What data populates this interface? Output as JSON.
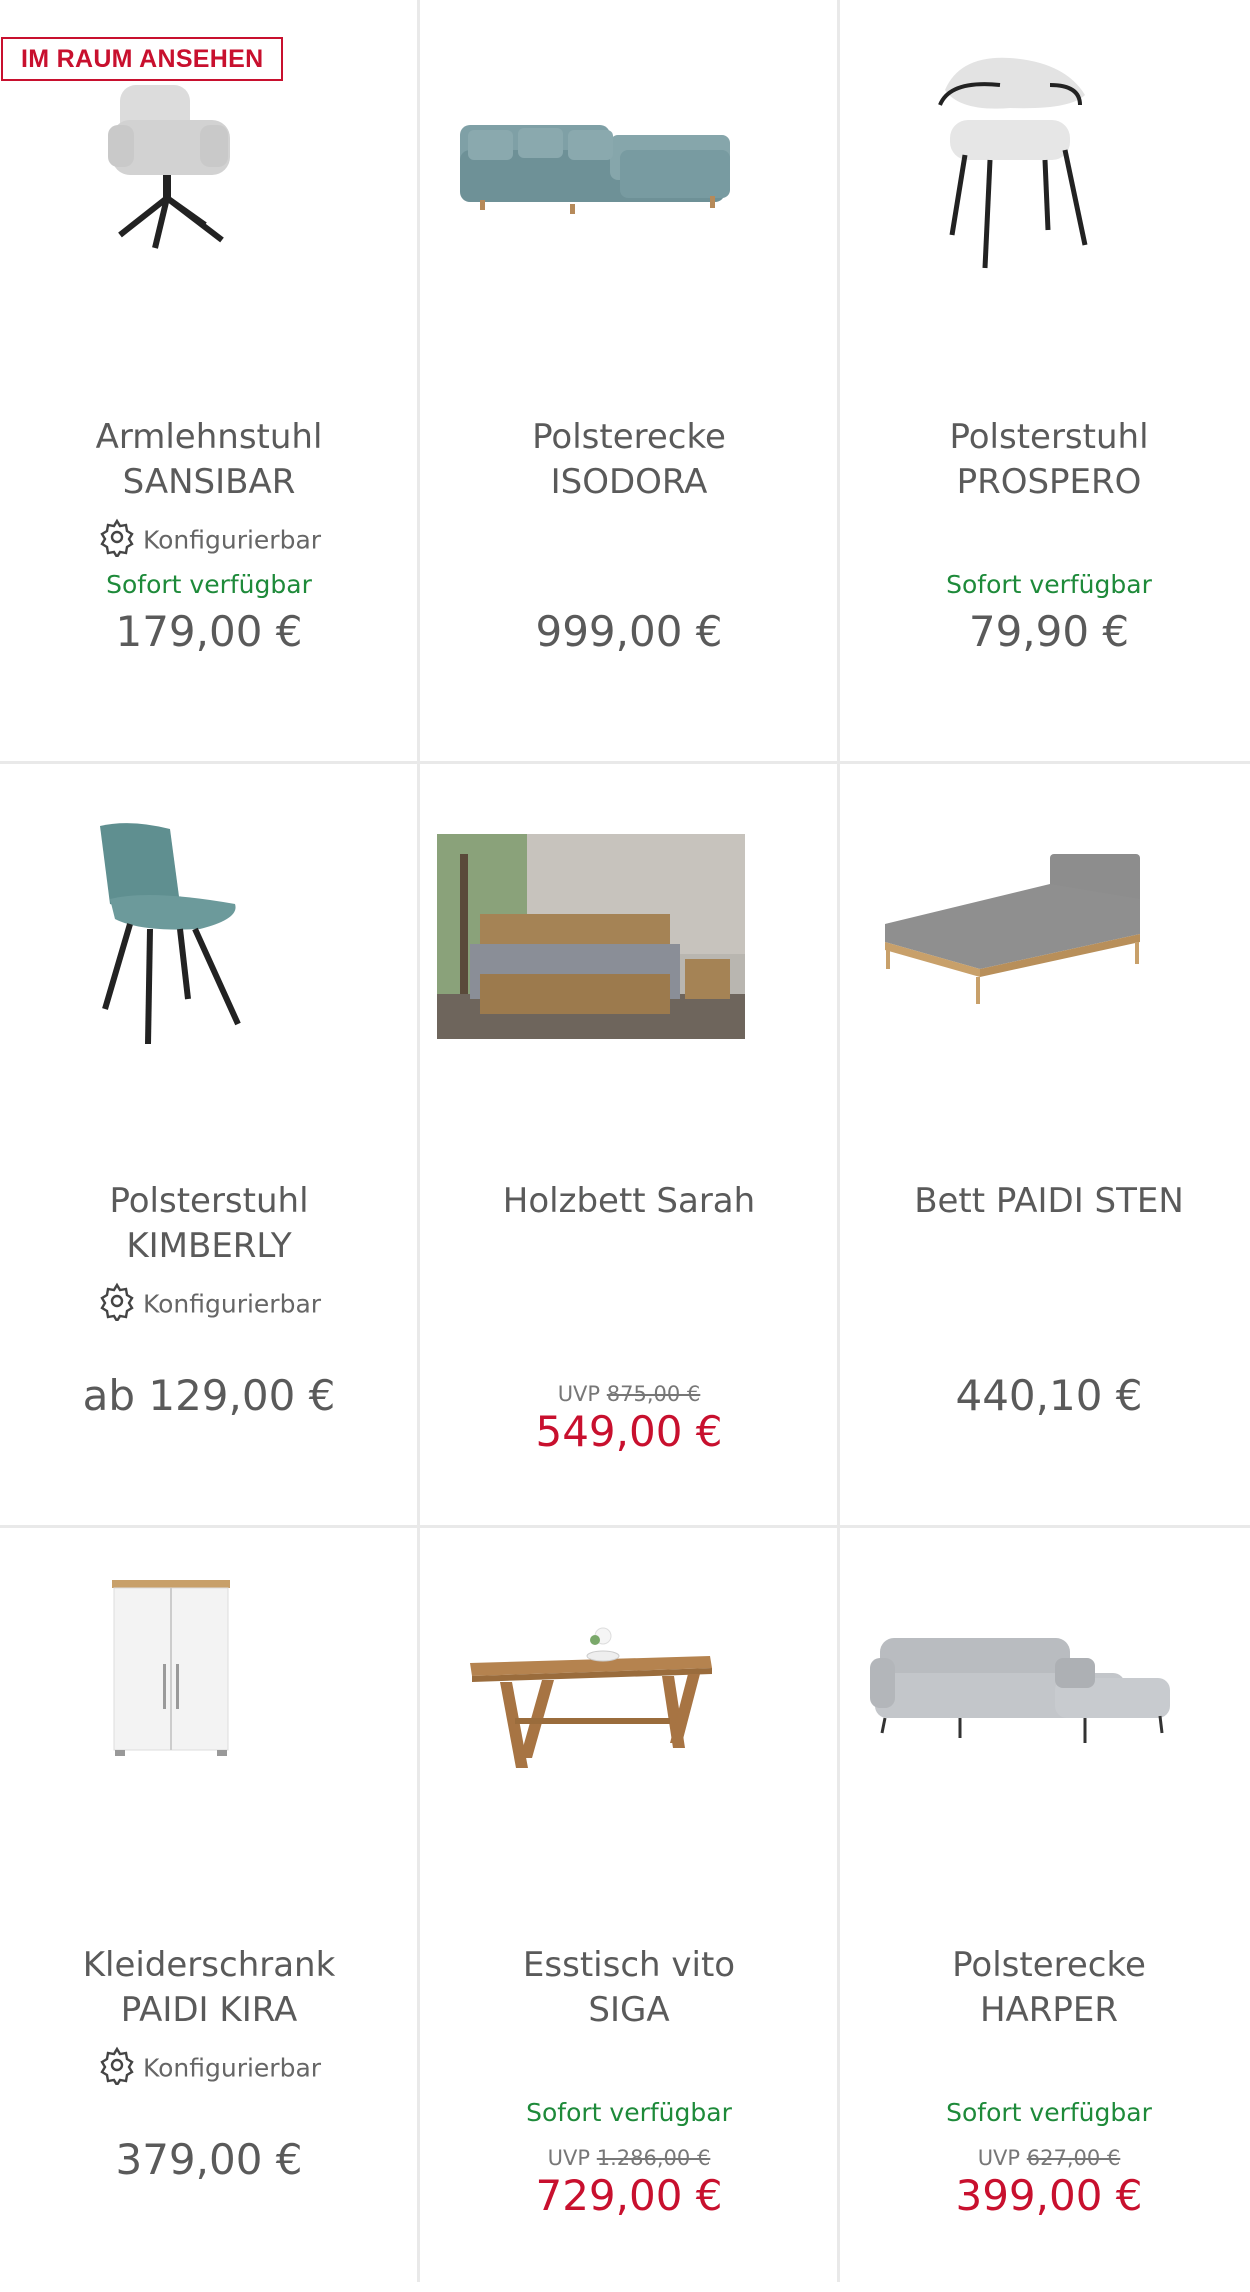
{
  "badge": "IM RAUM ANSEHEN",
  "config_label": "Konfigurierbar",
  "uvp_label": "UVP",
  "products": [
    {
      "line1": "Armlehnstuhl",
      "line2": "SANSIBAR",
      "config": true,
      "availability": "Sofort verfügbar",
      "price": "179,00 €",
      "image": "armchair-grey-swivel"
    },
    {
      "line1": "Polsterecke",
      "line2": "ISODORA",
      "config": false,
      "availability": "",
      "price": "999,00 €",
      "image": "corner-sofa-teal"
    },
    {
      "line1": "Polsterstuhl",
      "line2": "PROSPERO",
      "config": false,
      "availability": "Sofort verfügbar",
      "price": "79,90 €",
      "image": "upholstered-chair-white"
    },
    {
      "line1": "Polsterstuhl",
      "line2": "KIMBERLY",
      "config": true,
      "availability": "",
      "price": "ab 129,00 €",
      "image": "upholstered-chair-teal"
    },
    {
      "line1": "Holzbett Sarah",
      "line2": "",
      "config": false,
      "availability": "",
      "uvp": "875,00 €",
      "price": "549,00 €",
      "image": "wooden-bed-room"
    },
    {
      "line1": "Bett PAIDI STEN",
      "line2": "",
      "config": false,
      "availability": "",
      "price": "440,10 €",
      "image": "bed-grey-oak"
    },
    {
      "line1": "Kleiderschrank",
      "line2": "PAIDI KIRA",
      "config": true,
      "availability": "",
      "price": "379,00 €",
      "image": "wardrobe-white"
    },
    {
      "line1": "Esstisch vito",
      "line2": "SIGA",
      "config": false,
      "availability": "Sofort verfügbar",
      "uvp": "1.286,00 €",
      "price": "729,00 €",
      "image": "dining-table-oak"
    },
    {
      "line1": "Polsterecke",
      "line2": "HARPER",
      "config": false,
      "availability": "Sofort verfügbar",
      "uvp": "627,00 €",
      "price": "399,00 €",
      "image": "corner-sofa-grey"
    }
  ]
}
